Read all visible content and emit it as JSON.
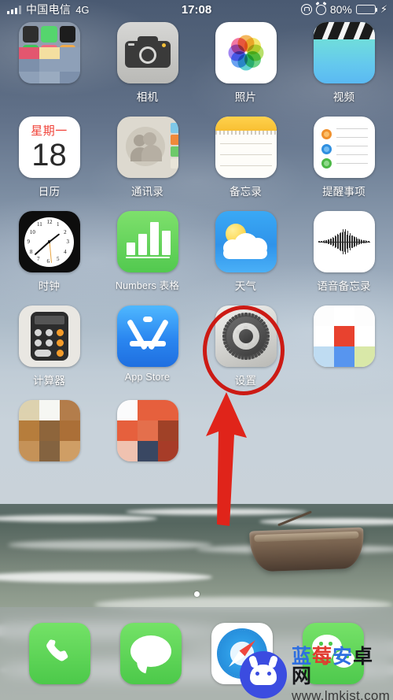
{
  "status_bar": {
    "signal_icon": "signal-bars-icon",
    "carrier": "中国电信",
    "network": "4G",
    "time": "17:08",
    "rotation_lock_icon": "rotation-lock-icon",
    "alarm_icon": "alarm-clock-icon",
    "battery_percent": "80%",
    "battery_level": 80,
    "charging_icon": "lightning-bolt-icon",
    "battery_color": "#4cd964"
  },
  "home_screen": {
    "rows": [
      [
        {
          "name": "folder",
          "label": "",
          "icon": "app-folder-icon",
          "censored": true
        },
        {
          "name": "camera",
          "label": "相机",
          "icon": "camera-icon"
        },
        {
          "name": "photos",
          "label": "照片",
          "icon": "photos-pinwheel-icon"
        },
        {
          "name": "videos",
          "label": "视频",
          "icon": "clapperboard-icon"
        }
      ],
      [
        {
          "name": "calendar",
          "label": "日历",
          "icon": "calendar-icon",
          "weekday": "星期一",
          "day": "18"
        },
        {
          "name": "contacts",
          "label": "通讯录",
          "icon": "contacts-icon"
        },
        {
          "name": "notes",
          "label": "备忘录",
          "icon": "notes-icon"
        },
        {
          "name": "reminders",
          "label": "提醒事项",
          "icon": "reminders-icon"
        }
      ],
      [
        {
          "name": "clock",
          "label": "时钟",
          "icon": "analog-clock-icon"
        },
        {
          "name": "numbers",
          "label": "Numbers 表格",
          "icon": "numbers-bar-chart-icon"
        },
        {
          "name": "weather",
          "label": "天气",
          "icon": "sun-cloud-icon"
        },
        {
          "name": "voice-memos",
          "label": "语音备忘录",
          "icon": "waveform-icon"
        }
      ],
      [
        {
          "name": "calculator",
          "label": "计算器",
          "icon": "calculator-icon"
        },
        {
          "name": "app-store",
          "label": "App Store",
          "icon": "app-store-icon"
        },
        {
          "name": "settings",
          "label": "设置",
          "icon": "gear-icon",
          "highlighted": true
        },
        {
          "name": "censored-app-1",
          "label": "",
          "icon": "mosaic-icon",
          "censored": true
        }
      ],
      [
        {
          "name": "censored-app-2",
          "label": "",
          "icon": "mosaic-icon",
          "censored": true
        },
        {
          "name": "censored-app-3",
          "label": "",
          "icon": "mosaic-icon",
          "censored": true
        }
      ]
    ]
  },
  "annotation": {
    "highlight_shape": "ellipse",
    "highlight_target": "设置",
    "highlight_color": "#cc1a14",
    "arrow_icon": "up-arrow-annotation",
    "arrow_color": "#e0241a"
  },
  "page_indicator": {
    "total_pages": 1,
    "current_page": 1
  },
  "dock": {
    "items": [
      {
        "name": "phone",
        "icon": "phone-handset-icon",
        "color": "#4cc94a"
      },
      {
        "name": "messages",
        "icon": "speech-bubble-icon",
        "color": "#4cc94a"
      },
      {
        "name": "safari",
        "icon": "compass-icon",
        "color": "#2f9fe8"
      },
      {
        "name": "wechat",
        "icon": "wechat-bubbles-icon",
        "color": "#4cc94a"
      }
    ]
  },
  "watermark": {
    "logo_icon": "blueberry-android-mascot-icon",
    "site_name_chars": [
      "蓝",
      "莓",
      "安",
      "卓",
      "网"
    ],
    "site_name": "蓝莓安卓网",
    "url": "www.lmkjst.com"
  }
}
